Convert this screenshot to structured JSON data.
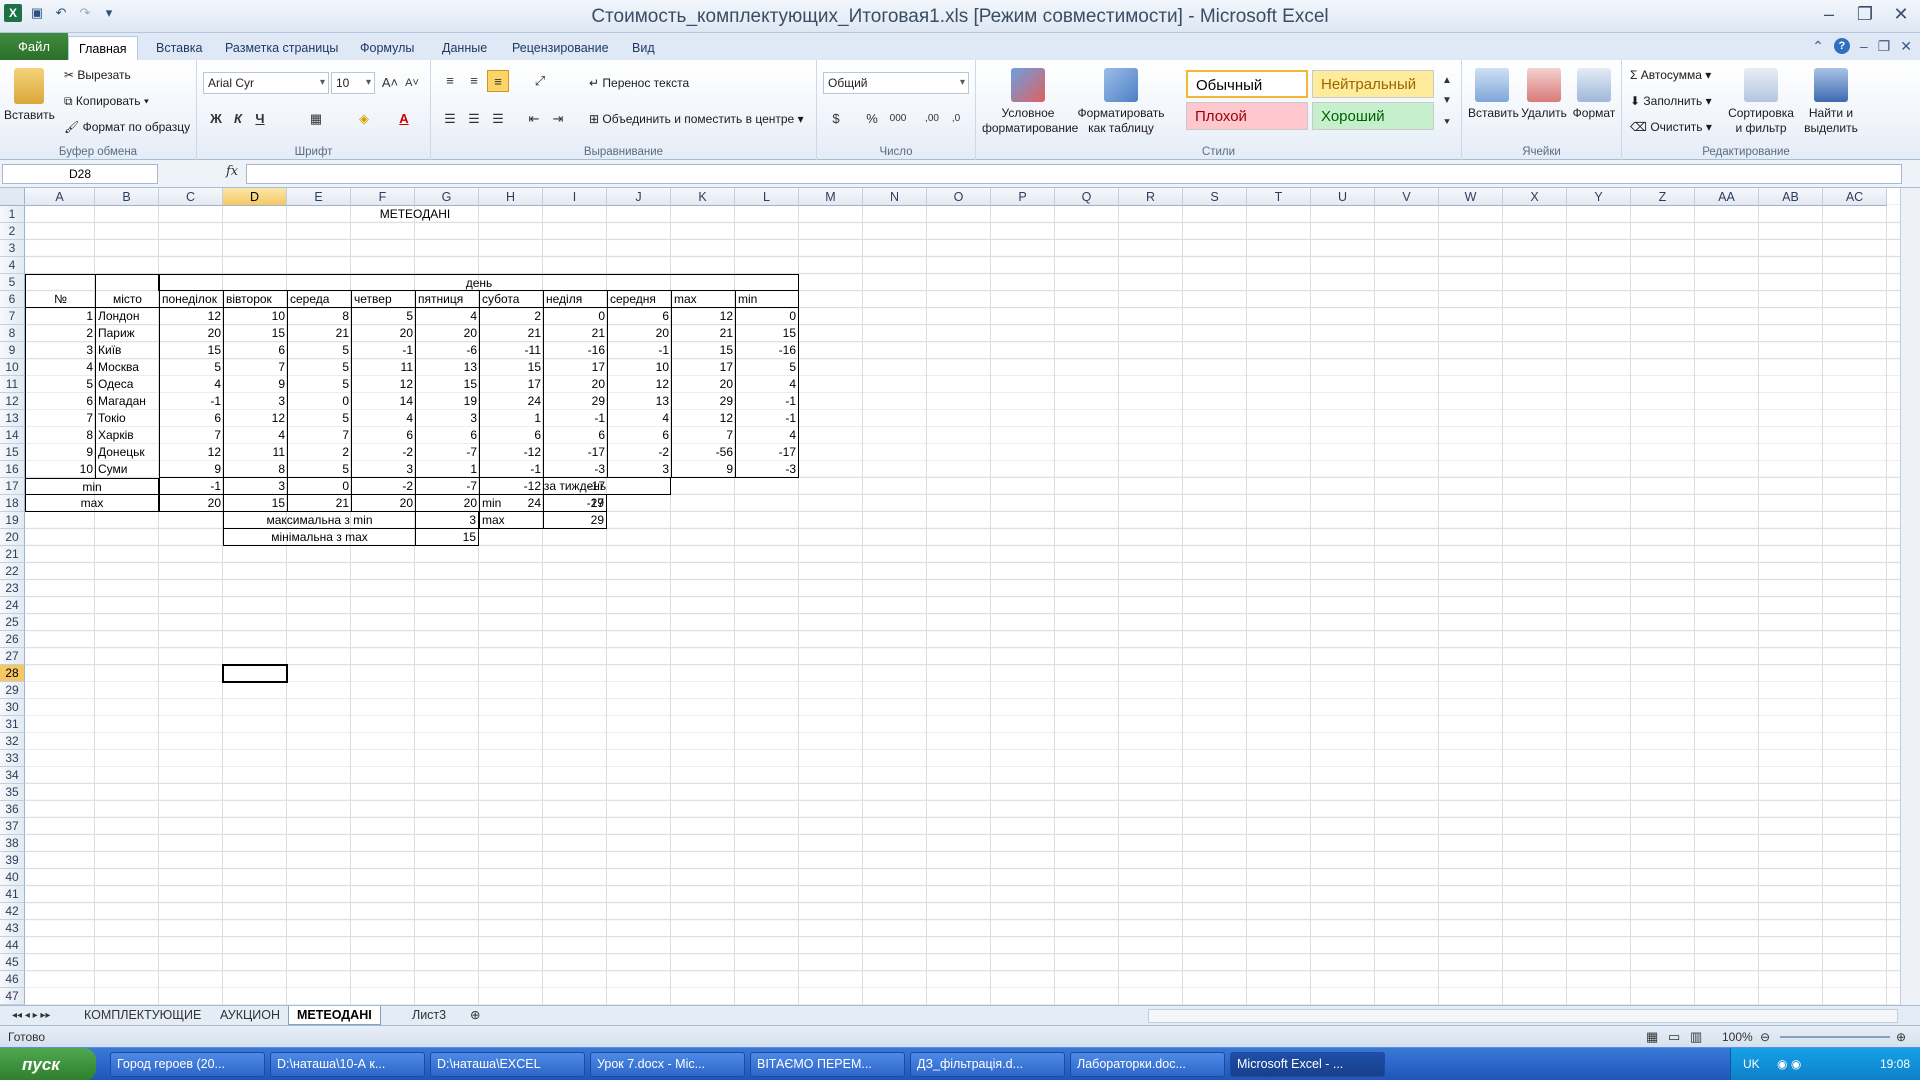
{
  "window": {
    "title": "Стоимость_комплектующих_Итоговая1.xls  [Режим совместимости]  -  Microsoft Excel"
  },
  "tabs": [
    "Файл",
    "Главная",
    "Вставка",
    "Разметка страницы",
    "Формулы",
    "Данные",
    "Рецензирование",
    "Вид"
  ],
  "ribbon": {
    "clipboard": {
      "paste": "Вставить",
      "cut": "Вырезать",
      "copy": "Копировать",
      "format_painter": "Формат по образцу",
      "group": "Буфер обмена"
    },
    "font": {
      "name": "Arial Cyr",
      "size": "10",
      "bold": "Ж",
      "italic": "К",
      "underline": "Ч",
      "group": "Шрифт"
    },
    "alignment": {
      "wrap": "Перенос текста",
      "merge": "Объединить и поместить в центре",
      "group": "Выравнивание"
    },
    "number": {
      "format": "Общий",
      "group": "Число"
    },
    "styles": {
      "conditional_1": "Условное",
      "conditional_2": "форматирование",
      "as_table_1": "Форматировать",
      "as_table_2": "как таблицу",
      "normal": "Обычный",
      "neutral": "Нейтральный",
      "bad": "Плохой",
      "good": "Хороший",
      "group": "Стили"
    },
    "cells": {
      "insert": "Вставить",
      "delete": "Удалить",
      "format": "Формат",
      "group": "Ячейки"
    },
    "editing": {
      "autosum": "Автосумма",
      "fill": "Заполнить",
      "clear": "Очистить",
      "sort_1": "Сортировка",
      "sort_2": "и фильтр",
      "find_1": "Найти и",
      "find_2": "выделить",
      "group": "Редактирование"
    }
  },
  "formula_bar": {
    "name_box": "D28",
    "fx": "fx",
    "value": ""
  },
  "columns": [
    "A",
    "B",
    "C",
    "D",
    "E",
    "F",
    "G",
    "H",
    "I",
    "J",
    "K",
    "L",
    "M",
    "N",
    "O",
    "P",
    "Q",
    "R",
    "S",
    "T",
    "U",
    "V",
    "W",
    "X",
    "Y",
    "Z",
    "AA",
    "AB",
    "AC"
  ],
  "sheet": {
    "title": "МЕТЕОДАНІ",
    "day_header": "день",
    "num_header": "№",
    "city_header": "місто",
    "day_cols": [
      "понеділок",
      "вівторок",
      "середа",
      "четвер",
      "пятниця",
      "субота",
      "неділя",
      "середня",
      "max",
      "min"
    ],
    "rows": [
      {
        "n": "1",
        "city": "Лондон",
        "v": [
          "12",
          "10",
          "8",
          "5",
          "4",
          "2",
          "0",
          "6",
          "12",
          "0"
        ]
      },
      {
        "n": "2",
        "city": "Париж",
        "v": [
          "20",
          "15",
          "21",
          "20",
          "20",
          "21",
          "21",
          "20",
          "21",
          "15"
        ]
      },
      {
        "n": "3",
        "city": "Київ",
        "v": [
          "15",
          "6",
          "5",
          "-1",
          "-6",
          "-11",
          "-16",
          "-1",
          "15",
          "-16"
        ]
      },
      {
        "n": "4",
        "city": "Москва",
        "v": [
          "5",
          "7",
          "5",
          "11",
          "13",
          "15",
          "17",
          "10",
          "17",
          "5"
        ]
      },
      {
        "n": "5",
        "city": "Одеса",
        "v": [
          "4",
          "9",
          "5",
          "12",
          "15",
          "17",
          "20",
          "12",
          "20",
          "4"
        ]
      },
      {
        "n": "6",
        "city": "Магадан",
        "v": [
          "-1",
          "3",
          "0",
          "14",
          "19",
          "24",
          "29",
          "13",
          "29",
          "-1"
        ]
      },
      {
        "n": "7",
        "city": "Токіо",
        "v": [
          "6",
          "12",
          "5",
          "4",
          "3",
          "1",
          "-1",
          "4",
          "12",
          "-1"
        ]
      },
      {
        "n": "8",
        "city": "Харків",
        "v": [
          "7",
          "4",
          "7",
          "6",
          "6",
          "6",
          "6",
          "6",
          "7",
          "4"
        ]
      },
      {
        "n": "9",
        "city": "Донецьк",
        "v": [
          "12",
          "11",
          "2",
          "-2",
          "-7",
          "-12",
          "-17",
          "-2",
          "-56",
          "-17"
        ]
      },
      {
        "n": "10",
        "city": "Суми",
        "v": [
          "9",
          "8",
          "5",
          "3",
          "1",
          "-1",
          "-3",
          "3",
          "9",
          "-3"
        ]
      }
    ],
    "min_label": "min",
    "min_values": [
      "-1",
      "3",
      "0",
      "-2",
      "-7",
      "-12",
      "-17"
    ],
    "max_label": "max",
    "max_values": [
      "20",
      "15",
      "21",
      "20",
      "20",
      "24",
      "29"
    ],
    "week_label": "за тиждень",
    "week_min_label": "min",
    "week_min_value": "-17",
    "week_max_label": "max",
    "week_max_value": "29",
    "max_of_min_label": "максимальна з min",
    "max_of_min_value": "3",
    "min_of_max_label": "мінімальна з max",
    "min_of_max_value": "15"
  },
  "sheet_tabs": [
    "КОМПЛЕКТУЮЩИЕ",
    "АУКЦИОН",
    "МЕТЕОДАНІ",
    "Лист3"
  ],
  "status": {
    "ready": "Готово",
    "zoom": "100%"
  },
  "taskbar": {
    "start": "пуск",
    "items": [
      "Город героев (20...",
      "D:\\наташа\\10-А к...",
      "D:\\наташа\\EXCEL",
      "Урок 7.docx - Mic...",
      "ВІТАЄМО ПЕРЕМ...",
      "ДЗ_фільтрація.d...",
      "Лабораторки.doc...",
      "Microsoft Excel - ..."
    ],
    "lang": "UK",
    "clock": "19:08"
  }
}
